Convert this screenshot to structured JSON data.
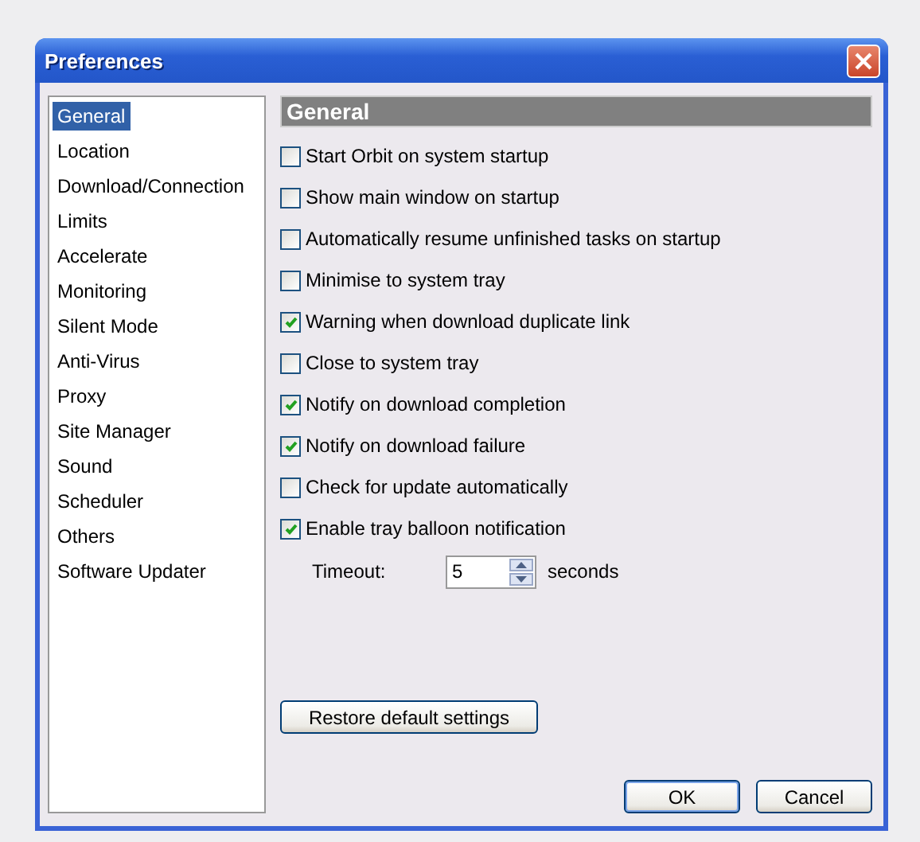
{
  "window": {
    "title": "Preferences"
  },
  "sidebar": {
    "items": [
      {
        "label": "General",
        "selected": true
      },
      {
        "label": "Location",
        "selected": false
      },
      {
        "label": "Download/Connection",
        "selected": false
      },
      {
        "label": "Limits",
        "selected": false
      },
      {
        "label": "Accelerate",
        "selected": false
      },
      {
        "label": "Monitoring",
        "selected": false
      },
      {
        "label": "Silent Mode",
        "selected": false
      },
      {
        "label": "Anti-Virus",
        "selected": false
      },
      {
        "label": "Proxy",
        "selected": false
      },
      {
        "label": "Site Manager",
        "selected": false
      },
      {
        "label": "Sound",
        "selected": false
      },
      {
        "label": "Scheduler",
        "selected": false
      },
      {
        "label": "Others",
        "selected": false
      },
      {
        "label": "Software Updater",
        "selected": false
      }
    ]
  },
  "section": {
    "title": "General"
  },
  "options": [
    {
      "label": "Start Orbit on system startup",
      "checked": false
    },
    {
      "label": "Show main window on startup",
      "checked": false
    },
    {
      "label": "Automatically resume unfinished tasks on startup",
      "checked": false
    },
    {
      "label": "Minimise to system tray",
      "checked": false
    },
    {
      "label": "Warning when download duplicate link",
      "checked": true
    },
    {
      "label": "Close to system tray",
      "checked": false
    },
    {
      "label": "Notify on download completion",
      "checked": true
    },
    {
      "label": "Notify on download failure",
      "checked": true
    },
    {
      "label": "Check for update automatically",
      "checked": false
    },
    {
      "label": "Enable tray balloon notification",
      "checked": true
    }
  ],
  "timeout": {
    "label": "Timeout:",
    "value": "5",
    "unit": "seconds"
  },
  "restore_button": "Restore default settings",
  "buttons": [
    "OK",
    "Cancel"
  ]
}
